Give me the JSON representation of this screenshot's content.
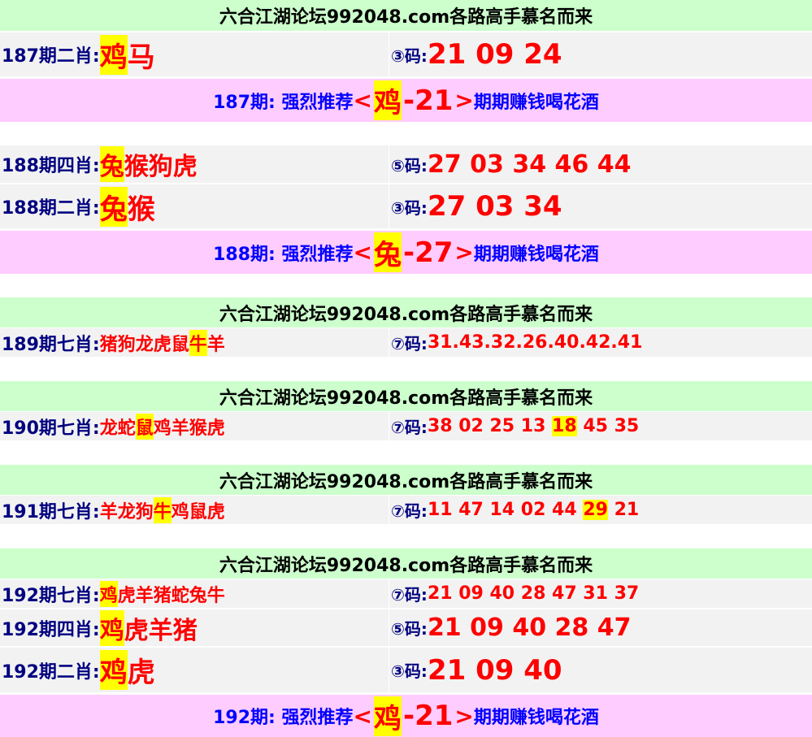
{
  "forum_title": "六合江湖论坛992048.com各路高手慕名而来",
  "sections": {
    "p187": {
      "r1_label": "187期二肖:",
      "r1_z_hl": "鸡",
      "r1_z_rest": "马",
      "r1_circ": "③码:",
      "r1_nums": "21 09 24",
      "promo_pre": "187期: 强烈推荐",
      "promo_lt": "<",
      "promo_z": "鸡",
      "promo_num": "-21",
      "promo_gt": ">",
      "promo_post": "期期赚钱喝花酒"
    },
    "p188": {
      "r1_label": "188期四肖:",
      "r1_z_hl": "兔",
      "r1_z_rest": "猴狗虎",
      "r1_circ": "⑤码:",
      "r1_nums": "27 03 34 46 44",
      "r2_label": "188期二肖:",
      "r2_z_hl": "兔",
      "r2_z_rest": "猴",
      "r2_circ": "③码:",
      "r2_nums": "27 03 34",
      "promo_pre": "188期: 强烈推荐",
      "promo_lt": "<",
      "promo_z": "兔",
      "promo_num": "-27",
      "promo_gt": ">",
      "promo_post": "期期赚钱喝花酒"
    },
    "p189": {
      "label": "189期七肖:",
      "z_pre": "猪狗龙虎鼠",
      "z_hl": "牛",
      "z_post": "羊",
      "circ": "⑦码:",
      "nums": "31.43.32.26.40.42.41"
    },
    "p190": {
      "label": "190期七肖:",
      "z_pre": "龙蛇",
      "z_hl": "鼠",
      "z_post": "鸡羊猴虎",
      "circ": "⑦码:",
      "nums_pre": "38 02 25 13 ",
      "nums_hl": "18",
      "nums_post": " 45 35"
    },
    "p191": {
      "label": "191期七肖:",
      "z_pre": "羊龙狗",
      "z_hl": "牛",
      "z_post": "鸡鼠虎",
      "circ": "⑦码:",
      "nums_pre": "11 47 14 02 44 ",
      "nums_hl": "29",
      "nums_post": " 21"
    },
    "p192": {
      "r1_label": "192期七肖:",
      "r1_z_hl": "鸡",
      "r1_z_rest": "虎羊猪蛇兔牛",
      "r1_circ": "⑦码:",
      "r1_nums": "21 09 40 28 47 31 37",
      "r2_label": "192期四肖:",
      "r2_z_hl": "鸡",
      "r2_z_rest": "虎羊猪",
      "r2_circ": "⑤码:",
      "r2_nums": "21 09 40 28 47",
      "r3_label": "192期二肖:",
      "r3_z_hl": "鸡",
      "r3_z_rest": "虎",
      "r3_circ": "③码:",
      "r3_nums": "21 09 40",
      "promo_pre": "192期: 强烈推荐",
      "promo_lt": "<",
      "promo_z": "鸡",
      "promo_num": "-21",
      "promo_gt": ">",
      "promo_post": "期期赚钱喝花酒"
    }
  },
  "colors": {
    "header_bg": "#ccffcc",
    "row_bg": "#f2f2f2",
    "promo_bg": "#ffccff",
    "highlight": "#ffff00",
    "zodiac": "#ff0000",
    "label": "#000080",
    "promo_text": "#0000ff"
  }
}
